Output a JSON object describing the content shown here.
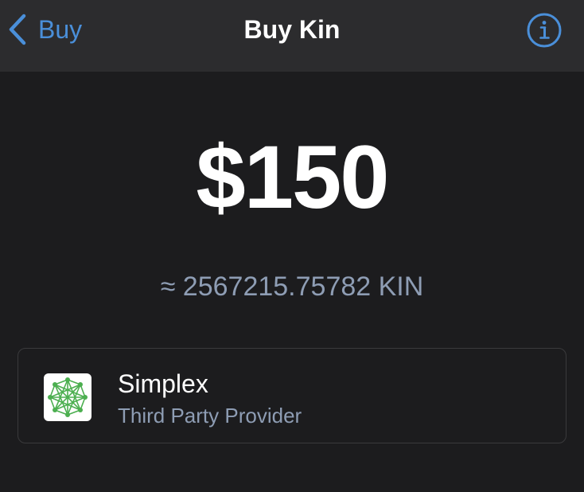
{
  "nav": {
    "back_label": "Buy",
    "title": "Buy Kin",
    "back_icon": "chevron-left-icon",
    "info_icon": "info-circle-icon"
  },
  "purchase": {
    "amount": "$150",
    "conversion": "≈ 2567215.75782 KIN"
  },
  "provider": {
    "name": "Simplex",
    "subtitle": "Third Party Provider",
    "logo_icon": "simplex-logo"
  },
  "colors": {
    "background": "#1c1c1e",
    "nav_background": "#2c2c2e",
    "accent": "#4a8fd9",
    "secondary_text": "#8e9db4",
    "card_border": "#3a3a3c",
    "logo_green": "#4caf50"
  }
}
